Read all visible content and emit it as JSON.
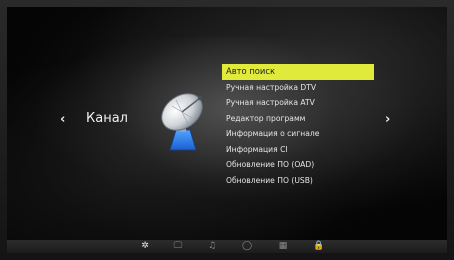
{
  "category": {
    "title": "Канал",
    "left_arrow": "‹",
    "right_arrow": "›"
  },
  "menu": {
    "items": [
      {
        "label": "Авто поиск",
        "selected": true
      },
      {
        "label": "Ручная настройка DTV",
        "selected": false
      },
      {
        "label": "Ручная настройка ATV",
        "selected": false
      },
      {
        "label": "Редактор программ",
        "selected": false
      },
      {
        "label": "Информация о сигнале",
        "selected": false
      },
      {
        "label": "Информация CI",
        "selected": false
      },
      {
        "label": "Обновление ПО (OAD)",
        "selected": false
      },
      {
        "label": "Обновление  ПО (USB)",
        "selected": false
      }
    ]
  },
  "bottom_tabs": [
    {
      "icon": "channel-gear-icon",
      "glyph": "✲",
      "active": true
    },
    {
      "icon": "monitor-icon",
      "glyph": "🖵",
      "active": false
    },
    {
      "icon": "music-note-icon",
      "glyph": "♫",
      "active": false
    },
    {
      "icon": "clock-icon",
      "glyph": "◯",
      "active": false
    },
    {
      "icon": "grid-icon",
      "glyph": "▦",
      "active": false
    },
    {
      "icon": "lock-icon",
      "glyph": "🔒",
      "active": false
    }
  ],
  "colors": {
    "selected_bg": "#e0ea3a",
    "text": "#e6e6e6"
  }
}
